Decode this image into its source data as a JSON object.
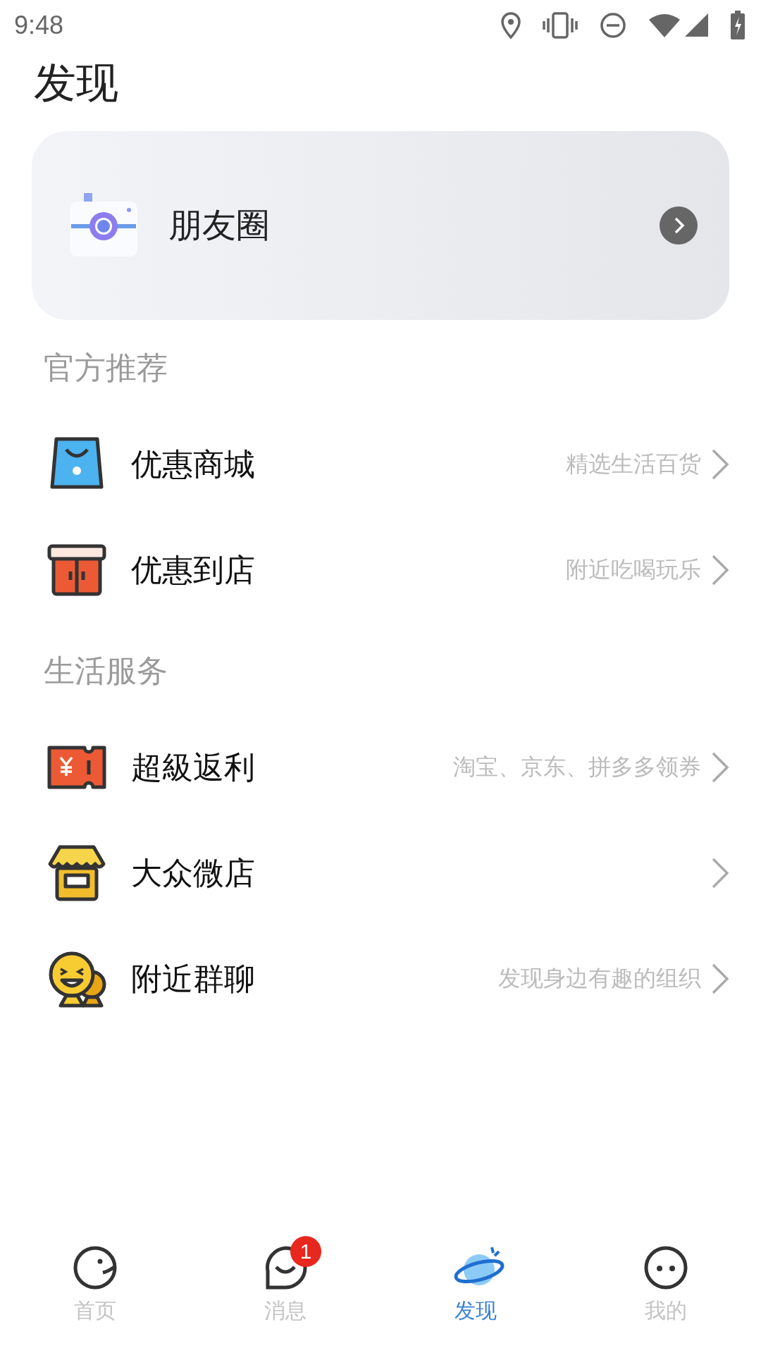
{
  "status_bar": {
    "time": "9:48"
  },
  "title": "发现",
  "moments": {
    "label": "朋友圈"
  },
  "sections": [
    {
      "header": "官方推荐",
      "items": [
        {
          "kind": "bag",
          "label": "优惠商城",
          "subtitle": "精选生活百货"
        },
        {
          "kind": "store",
          "label": "优惠到店",
          "subtitle": "附近吃喝玩乐"
        }
      ]
    },
    {
      "header": "生活服务",
      "items": [
        {
          "kind": "ticket",
          "label": "超級返利",
          "subtitle": "淘宝、京东、拼多多领券"
        },
        {
          "kind": "shop",
          "label": "大众微店"
        },
        {
          "kind": "people",
          "label": "附近群聊",
          "subtitle": "发现身边有趣的组织"
        }
      ]
    }
  ],
  "tabs": [
    {
      "kind": "home",
      "label": "首页",
      "selected": false
    },
    {
      "kind": "chat",
      "label": "消息",
      "selected": false,
      "badge": "1"
    },
    {
      "kind": "planet",
      "label": "发现",
      "selected": true
    },
    {
      "kind": "face",
      "label": "我的",
      "selected": false
    }
  ]
}
